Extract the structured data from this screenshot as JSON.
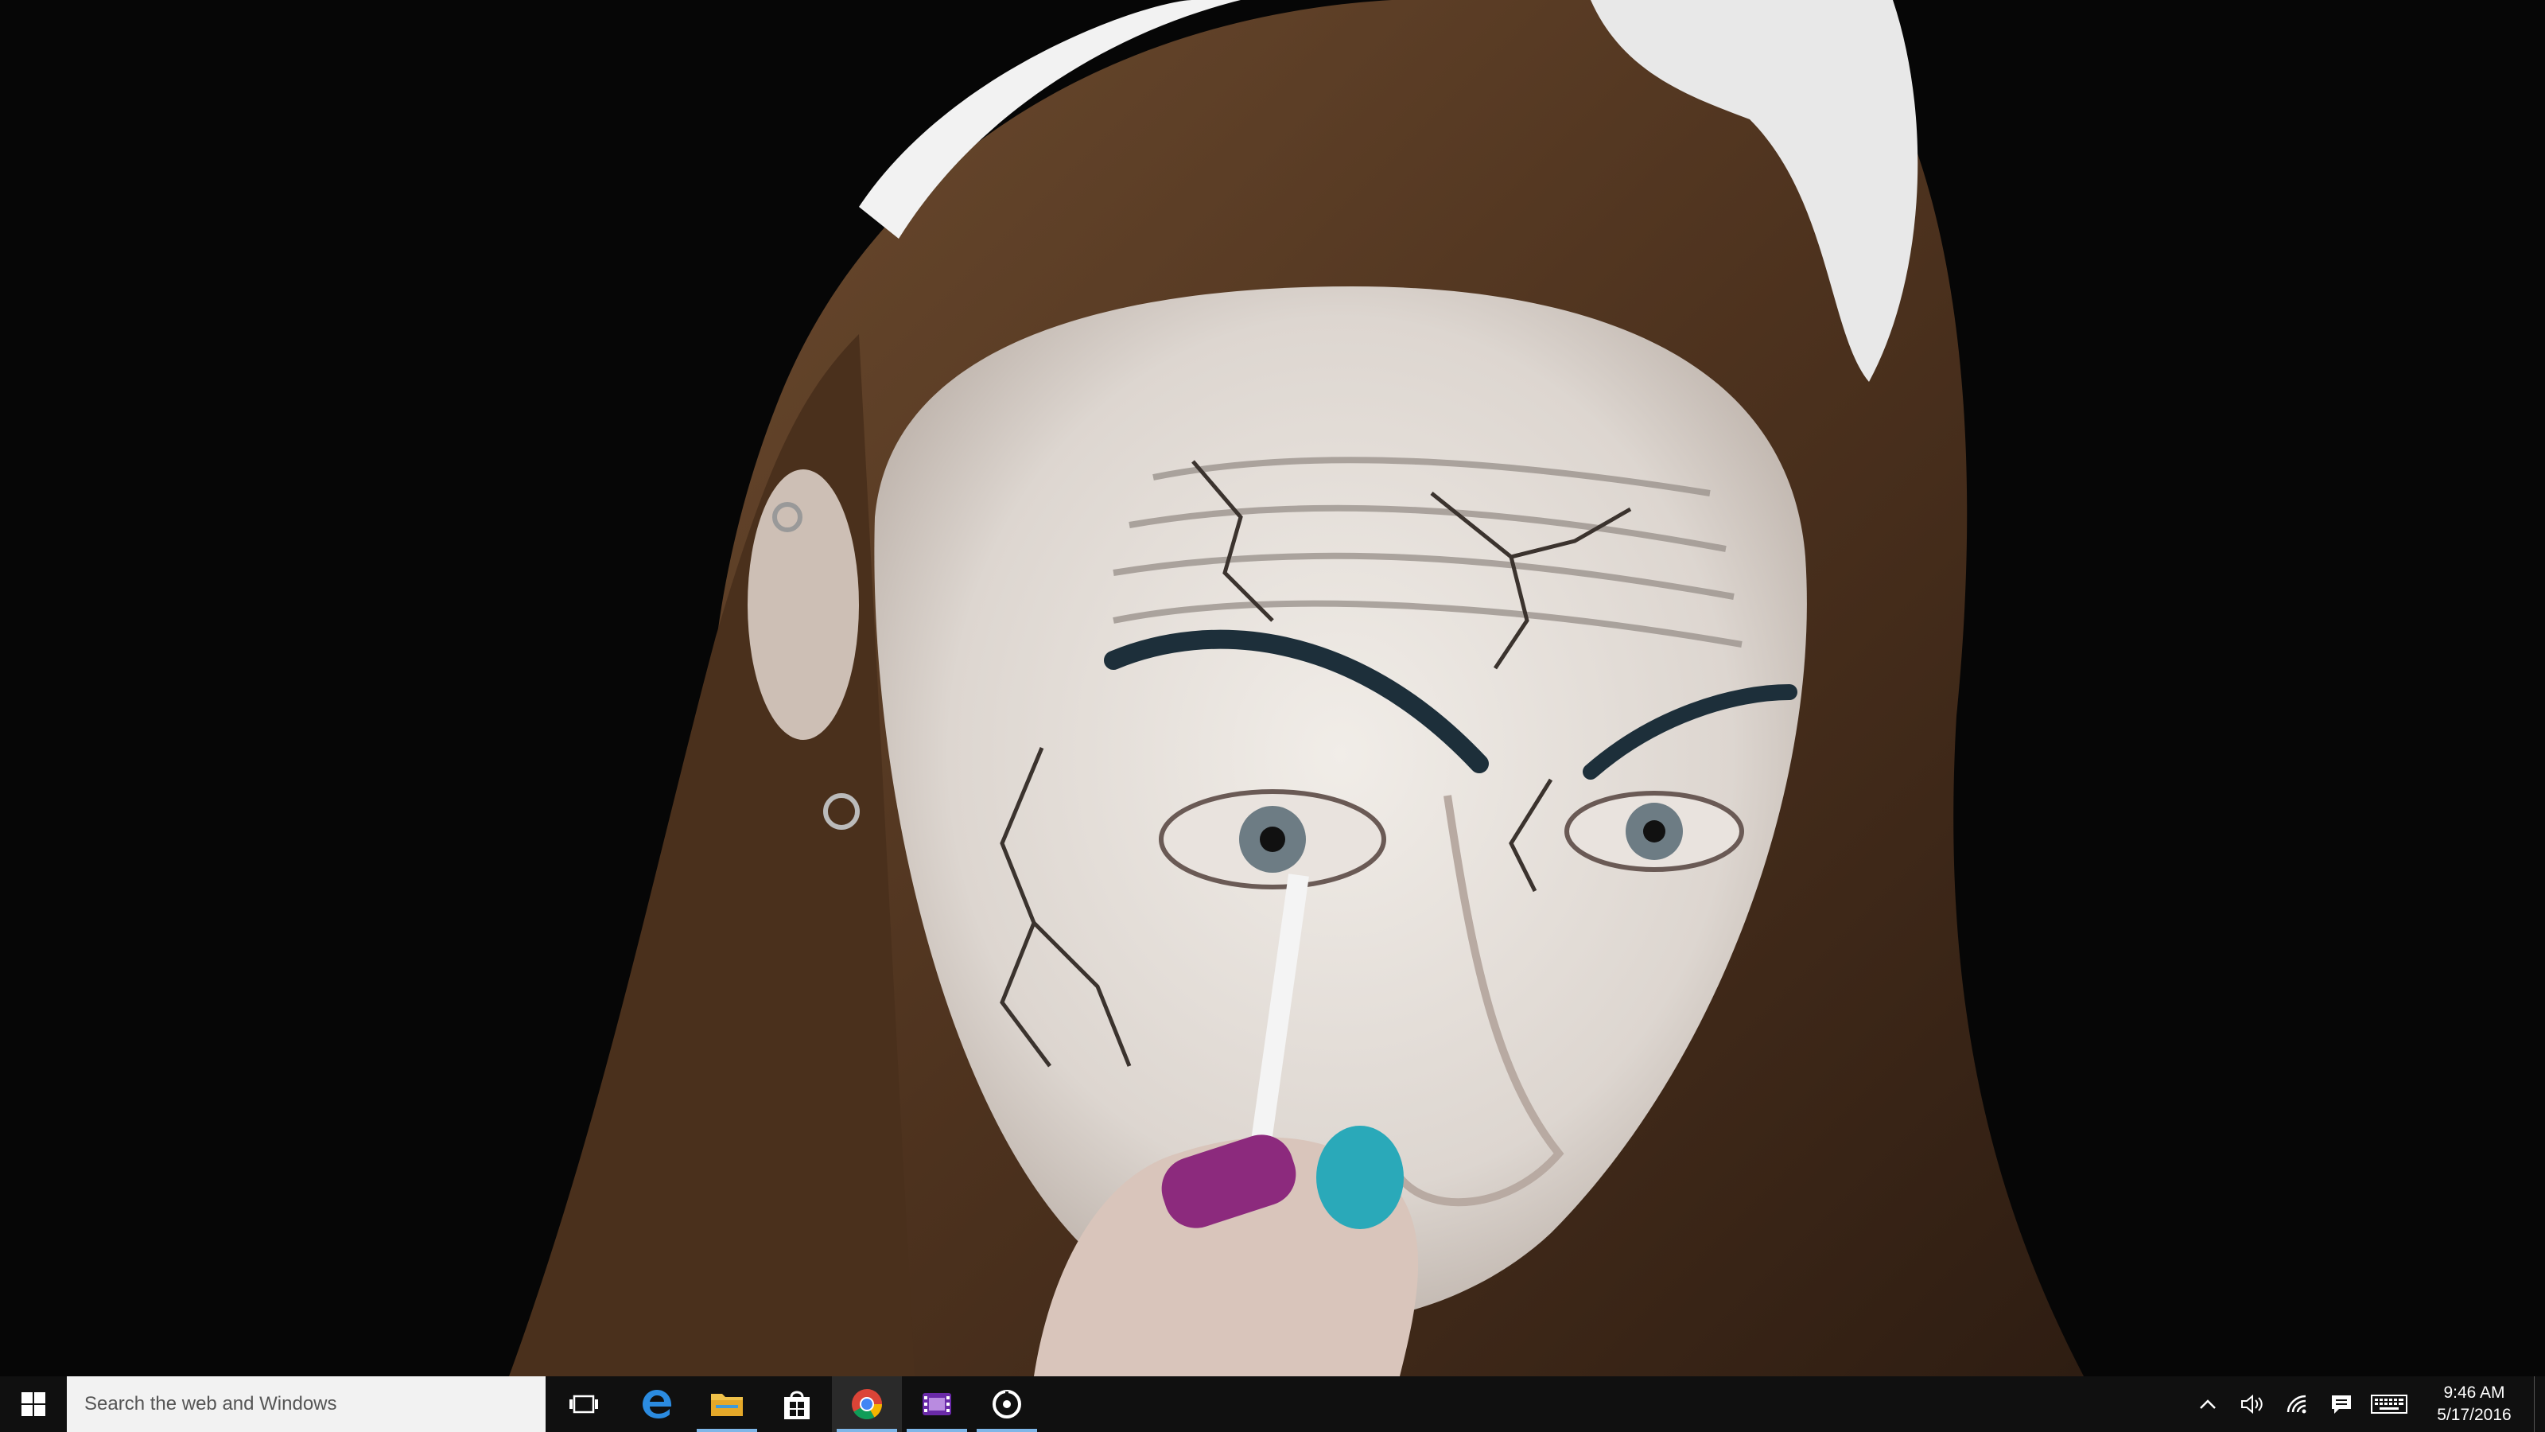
{
  "desktop": {
    "content": "video-frame",
    "colors": {
      "background": "#050505",
      "hair": "#5a3a22",
      "skin": "#e6e1dc",
      "eyebrow": "#1d2f3a"
    }
  },
  "taskbar": {
    "search": {
      "placeholder": "Search the web and Windows"
    },
    "pinned": [
      {
        "name": "edge",
        "icon": "edge-icon"
      },
      {
        "name": "file-explorer",
        "icon": "folder-icon"
      },
      {
        "name": "store",
        "icon": "store-bag-icon"
      },
      {
        "name": "chrome",
        "icon": "chrome-icon"
      },
      {
        "name": "video-editor",
        "icon": "film-icon"
      },
      {
        "name": "media-player",
        "icon": "disc-icon"
      }
    ],
    "tray": {
      "icons": [
        "chevron-up-icon",
        "volume-icon",
        "wifi-icon",
        "action-center-icon",
        "keyboard-icon"
      ],
      "clock": {
        "time": "9:46 AM",
        "date": "5/17/2016"
      }
    },
    "colors": {
      "background": "#101010",
      "running_indicator": "#7fb6e8",
      "search_bg": "#f2f2f2"
    }
  }
}
